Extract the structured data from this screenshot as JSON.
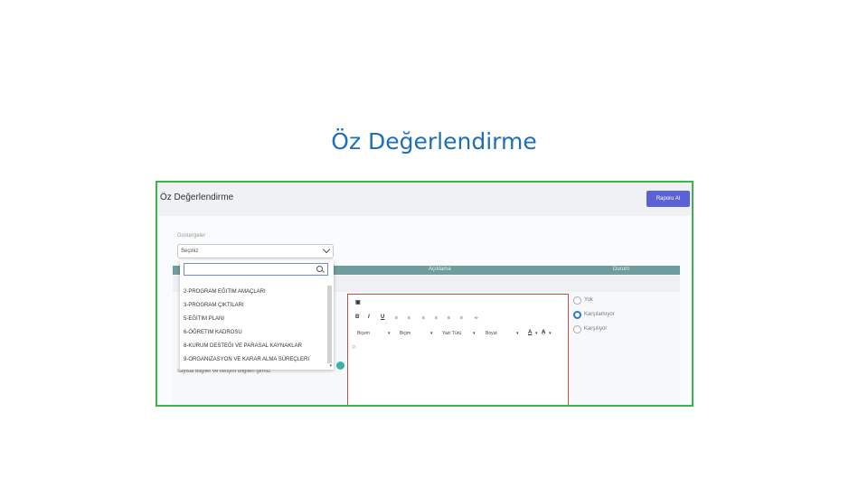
{
  "slide_title": "Öz Değerlendirme",
  "app": {
    "page_title": "Öz Değerlendirme",
    "report_button": "Raporu Al",
    "field_label": "Gostergeler",
    "select_value": "Seçiniz",
    "columns": [
      "Açıklama",
      "Durum"
    ],
    "dropdown_items": [
      "2-PROGRAM EĞITIM AMAÇLARI",
      "3-PROGRAM ÇIKTILARI",
      "5-EĞITIM PLANI",
      "6-ÖĞRETIM KADROSU",
      "8-KURUM DESTEĞI VE PARASAL KAYNAKLAR",
      "9-ORGANIZASYON VE KARAR ALMA SÜREÇLERI"
    ],
    "hint_text": "sayisal bilgiler ve iletişim bilgileri giriniz.",
    "editor": {
      "styles": "Biçem",
      "format": "Biçim",
      "font": "Yazı Türü",
      "size": "Boyut",
      "body_char": "p"
    },
    "status_options": [
      "Yok",
      "Karşılamıyor",
      "Karşılıyor"
    ],
    "status_selected": "Karşılamıyor"
  }
}
